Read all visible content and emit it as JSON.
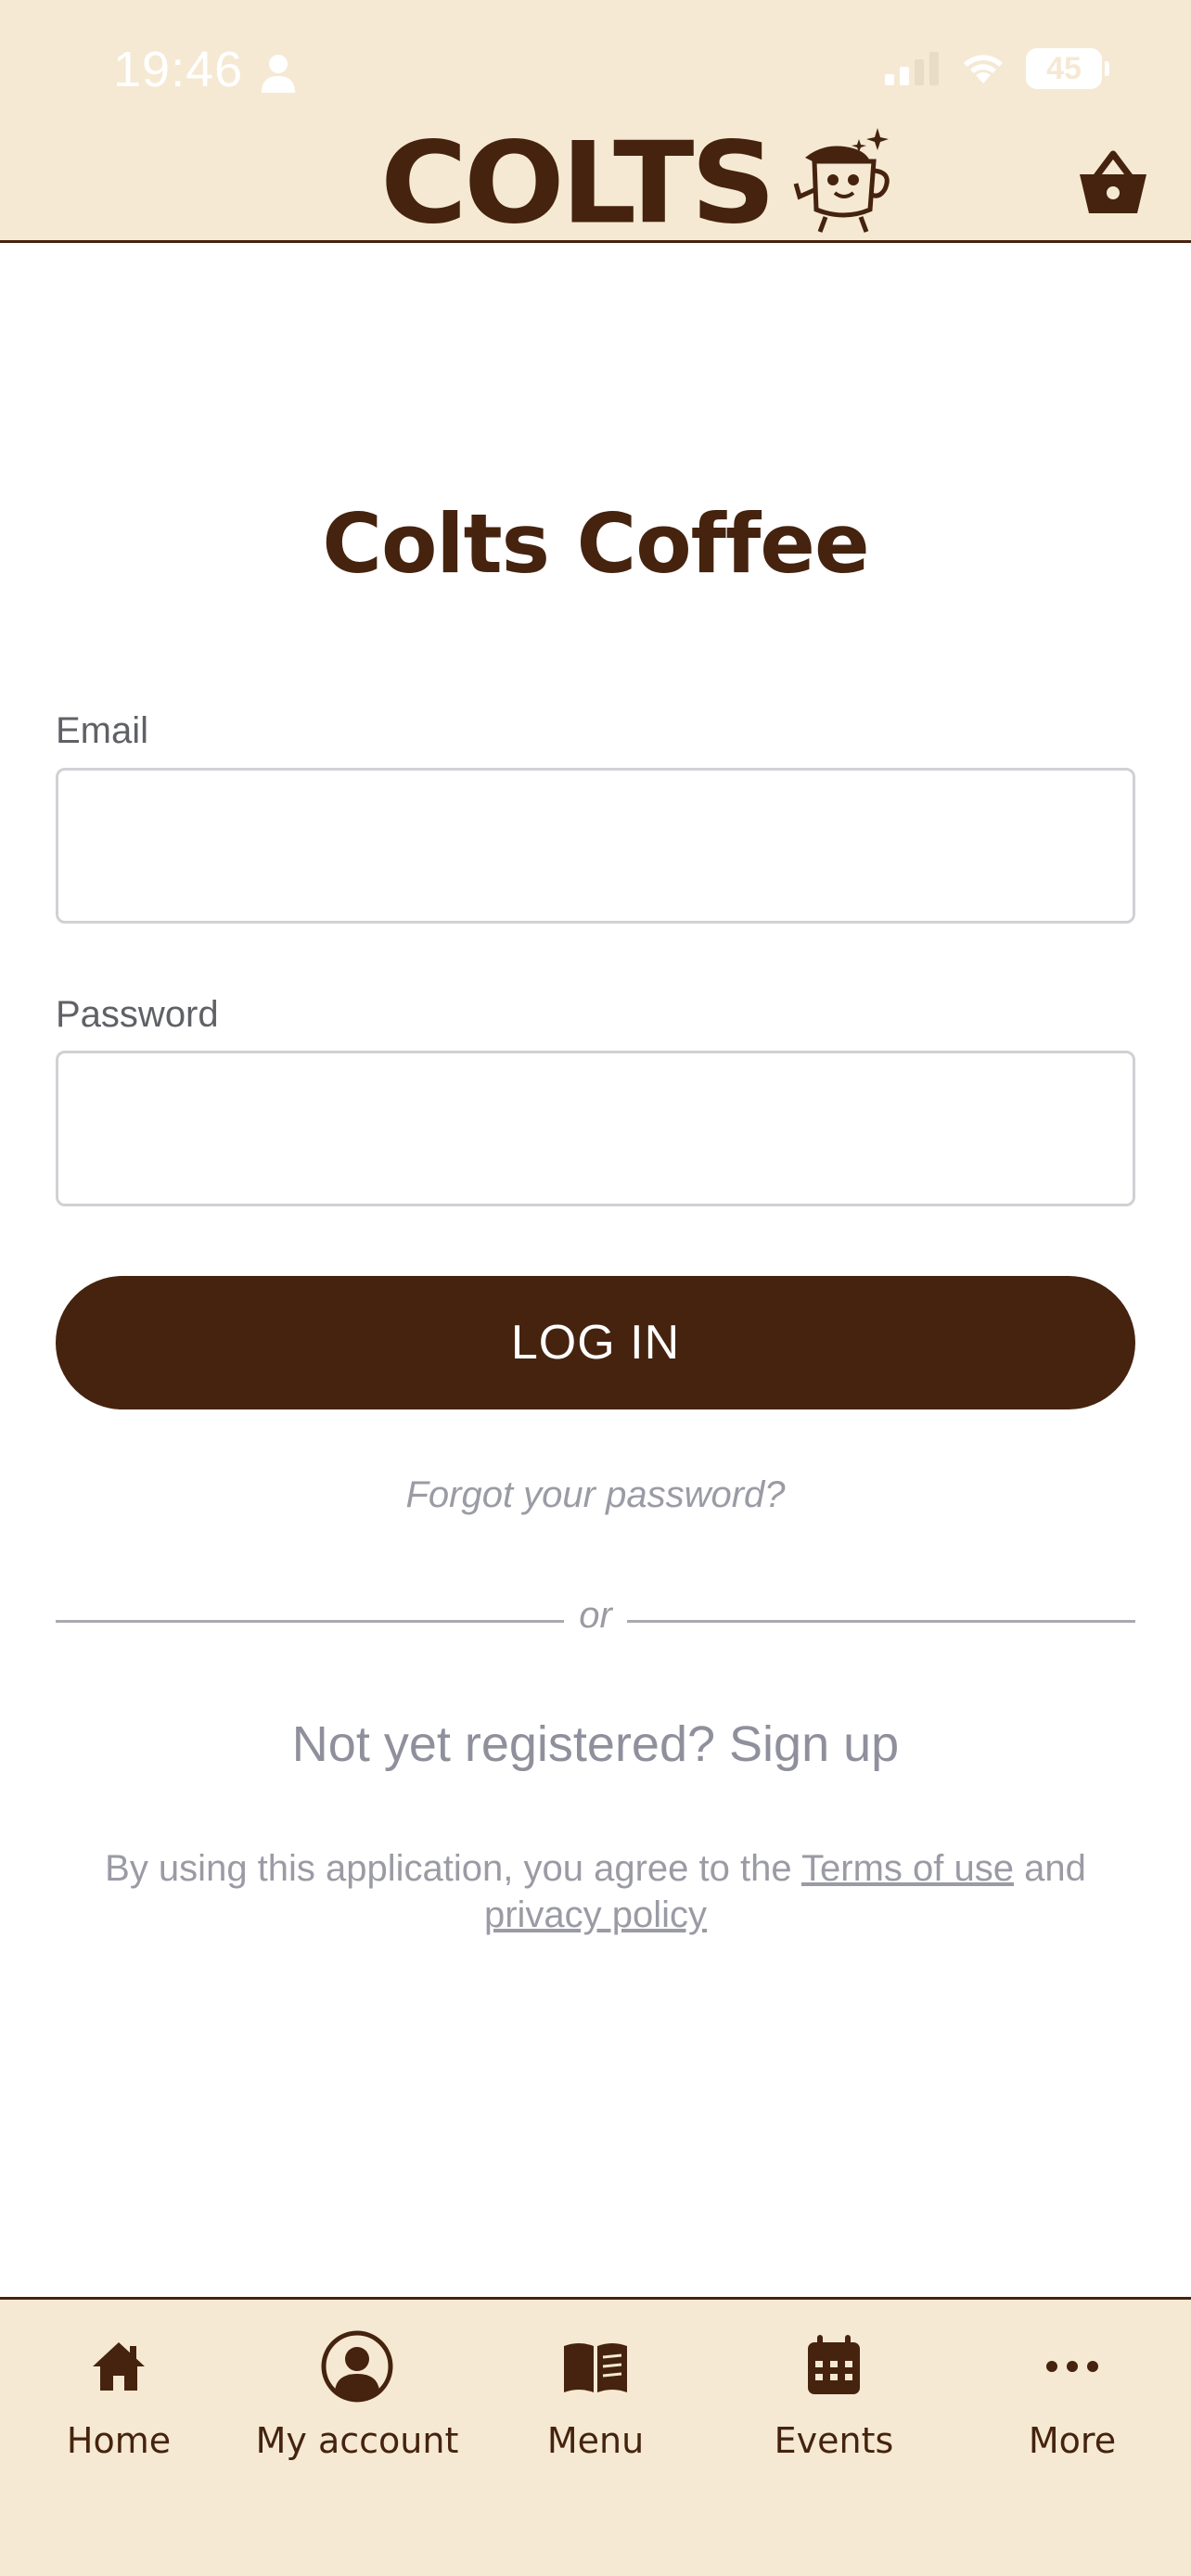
{
  "status_bar": {
    "time": "19:46",
    "battery": "45"
  },
  "header": {
    "brand": "COLTS",
    "icons": [
      "mascot-cup-logo",
      "shopping-basket-icon"
    ]
  },
  "login": {
    "title": "Colts Coffee",
    "email_label": "Email",
    "email_value": "",
    "password_label": "Password",
    "password_value": "",
    "submit_label": "LOG IN",
    "forgot_label": "Forgot your password?",
    "divider_label": "or",
    "signup_label": "Not yet registered? Sign up",
    "legal_prefix": "By using this application, you agree to the",
    "terms_label": "Terms of use",
    "legal_and": "and",
    "privacy_label": "privacy policy"
  },
  "tabbar": {
    "items": [
      {
        "label": "Home",
        "icon": "home-icon"
      },
      {
        "label": "My account",
        "icon": "account-icon"
      },
      {
        "label": "Menu",
        "icon": "book-icon"
      },
      {
        "label": "Events",
        "icon": "calendar-icon"
      },
      {
        "label": "More",
        "icon": "ellipsis-icon"
      }
    ]
  },
  "colors": {
    "brand_brown": "#45230e",
    "cream": "#f5e9d3",
    "muted_text": "#9a9ba4"
  }
}
